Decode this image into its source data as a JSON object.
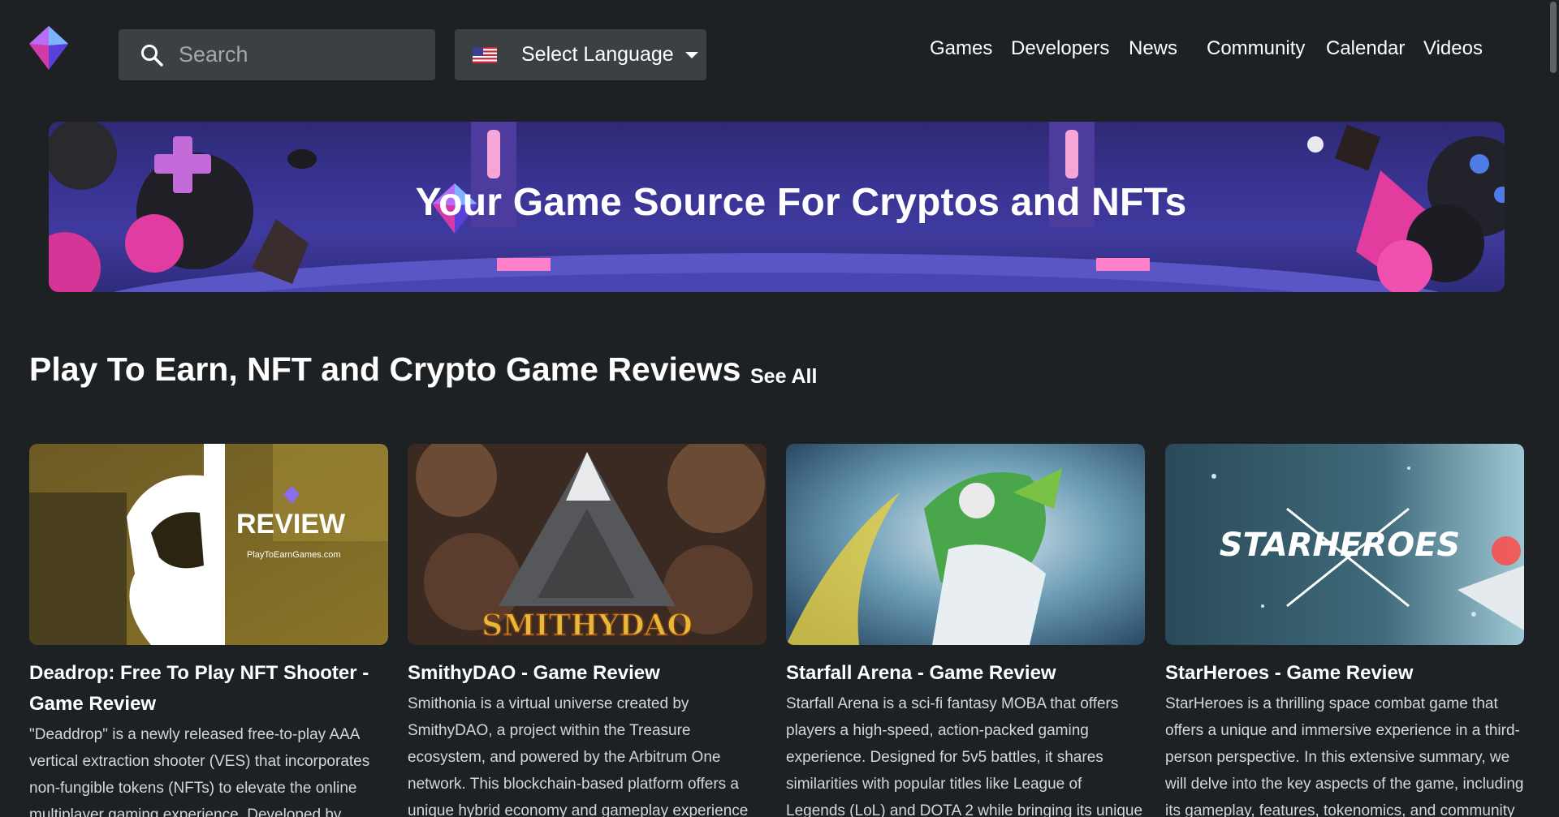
{
  "header": {
    "search_placeholder": "Search",
    "language_label": "Select Language",
    "nav": [
      {
        "label": "Games"
      },
      {
        "label": "Developers"
      },
      {
        "label": "News"
      },
      {
        "label": "Community"
      },
      {
        "label": "Calendar"
      },
      {
        "label": "Videos"
      }
    ]
  },
  "banner": {
    "title": "Your Game Source For Cryptos and NFTs"
  },
  "section": {
    "title": "Play To Earn, NFT and Crypto Game Reviews",
    "see_all": "See All"
  },
  "cards": [
    {
      "title": "Deadrop: Free To Play NFT Shooter - Game Review",
      "description": "\"Deaddrop\" is a newly released free-to-play AAA vertical extraction shooter (VES) that incorporates non-fungible tokens (NFTs) to elevate the online multiplayer gaming experience. Developed by",
      "image_text": "REVIEW",
      "image_subtext": "PlayToEarnGames.com"
    },
    {
      "title": "SmithyDAO - Game Review",
      "description": "Smithonia is a virtual universe created by SmithyDAO, a project within the Treasure ecosystem, and powered by the Arbitrum One network. This blockchain-based platform offers a unique hybrid economy and gameplay experience centered around staking and",
      "image_text": "SMITHYDAO"
    },
    {
      "title": "Starfall Arena - Game Review",
      "description": "Starfall Arena is a sci-fi fantasy MOBA that offers players a high-speed, action-packed gaming experience. Designed for 5v5 battles, it shares similarities with popular titles like League of Legends (LoL) and DOTA 2 while bringing its unique flavor to"
    },
    {
      "title": "StarHeroes - Game Review",
      "description": "StarHeroes is a thrilling space combat game that offers a unique and immersive experience in a third-person perspective. In this extensive summary, we will delve into the key aspects of the game, including its gameplay, features, tokenomics, and community",
      "image_text": "STARHEROES"
    }
  ],
  "colors": {
    "background": "#1d2123",
    "input_bg": "#3c4043",
    "banner_purple": "#3b3596",
    "accent_pink": "#e040a0",
    "text_muted": "#d4d7d9"
  },
  "icons": {
    "logo": "diamond-logo-icon",
    "search": "search-icon",
    "flag": "us-flag-icon",
    "caret": "caret-down-icon"
  }
}
